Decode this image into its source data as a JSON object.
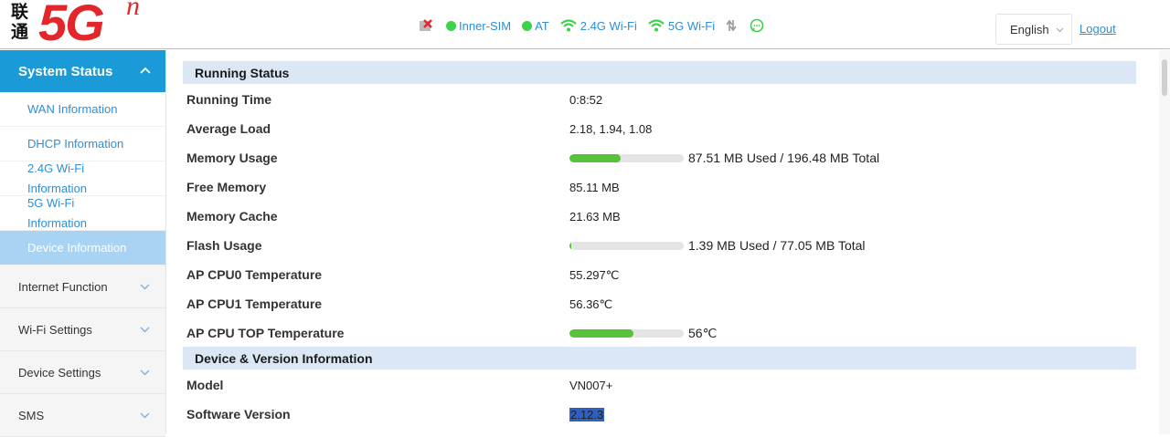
{
  "logo": {
    "cn": "联通",
    "main": "5G",
    "sup": "n"
  },
  "status": {
    "inner_sim": "Inner-SIM",
    "at": "AT",
    "wifi24": "2.4G Wi-Fi",
    "wifi5": "5G Wi-Fi",
    "accent_color": "#2b8fd9",
    "ok_color": "#3bd34a"
  },
  "header": {
    "language": "English",
    "logout": "Logout"
  },
  "sidebar": {
    "active_section": "System Status",
    "subitems": [
      {
        "label": "WAN Information"
      },
      {
        "label": "DHCP Information"
      },
      {
        "label_line1": "2.4G Wi-Fi",
        "label_line2": "Information"
      },
      {
        "label_line1": "5G Wi-Fi",
        "label_line2": "Information"
      },
      {
        "label": "Device Information"
      }
    ],
    "menus": [
      "Internet Function",
      "Wi-Fi Settings",
      "Device Settings",
      "SMS"
    ]
  },
  "running_status": {
    "title": "Running Status",
    "running_time": {
      "label": "Running Time",
      "value": "0:8:52"
    },
    "average_load": {
      "label": "Average Load",
      "value": "2.18, 1.94, 1.08"
    },
    "memory_usage": {
      "label": "Memory Usage",
      "text": "87.51 MB Used / 196.48 MB Total",
      "fraction": 0.445
    },
    "free_memory": {
      "label": "Free Memory",
      "value": "85.11 MB"
    },
    "memory_cache": {
      "label": "Memory Cache",
      "value": "21.63 MB"
    },
    "flash_usage": {
      "label": "Flash Usage",
      "text": "1.39 MB Used / 77.05 MB Total",
      "fraction": 0.018
    },
    "cpu0_temp": {
      "label": "AP CPU0 Temperature",
      "value": "55.297℃"
    },
    "cpu1_temp": {
      "label": "AP CPU1 Temperature",
      "value": "56.36℃"
    },
    "cpu_top_temp": {
      "label": "AP CPU TOP Temperature",
      "text": "56℃",
      "fraction": 0.56
    }
  },
  "device_info": {
    "title": "Device & Version Information",
    "model": {
      "label": "Model",
      "value": "VN007+"
    },
    "software_version": {
      "label": "Software Version",
      "value": "2.12.3"
    }
  }
}
